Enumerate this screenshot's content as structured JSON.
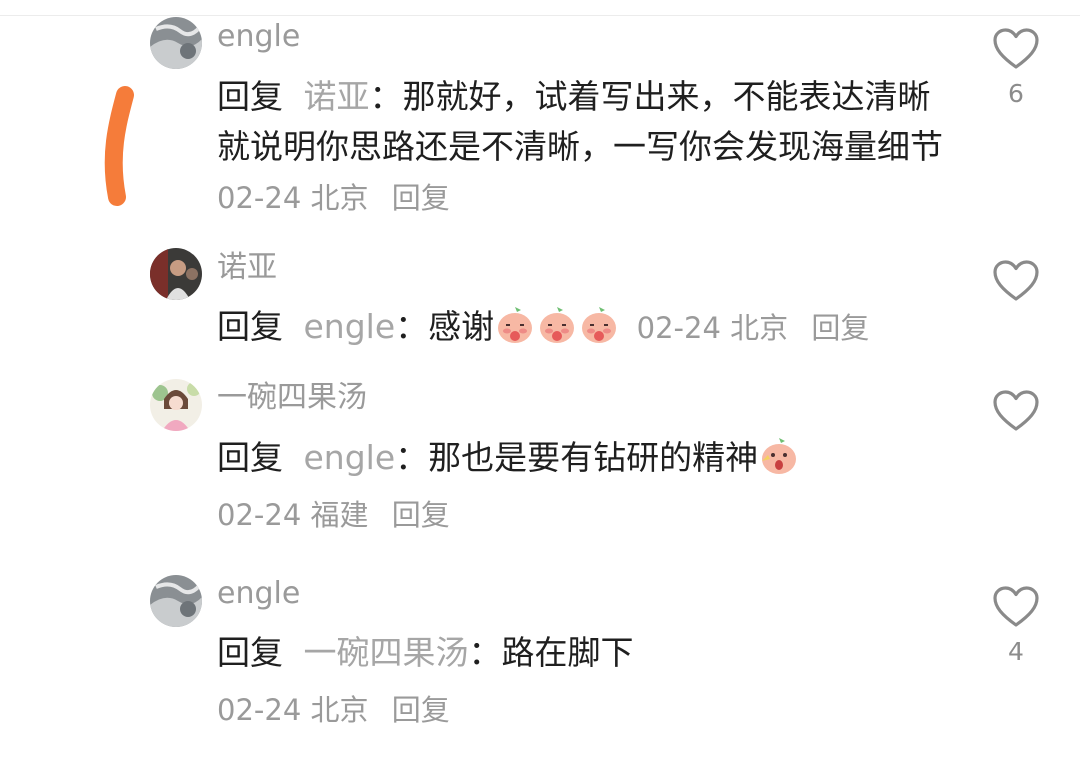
{
  "comments": [
    {
      "username": "engle",
      "reply_word": "回复",
      "reply_target": "诺亚",
      "colon": "：",
      "text": "那就好，试着写出来，不能表达清晰就说明你思路还是不清晰，一写你会发现海量细节",
      "date": "02-24",
      "location": "北京",
      "reply_link": "回复",
      "like_count": "6"
    },
    {
      "username": "诺亚",
      "reply_word": "回复",
      "reply_target": "engle",
      "colon": "：",
      "text": "感谢",
      "emojis": [
        "blush-emoji",
        "blush-emoji",
        "blush-emoji"
      ],
      "date": "02-24",
      "location": "北京",
      "reply_link": "回复",
      "like_count": ""
    },
    {
      "username": "一碗四果汤",
      "reply_word": "回复",
      "reply_target": "engle",
      "colon": "：",
      "text": "那也是要有钻研的精神",
      "emojis": [
        "wow-emoji"
      ],
      "date": "02-24",
      "location": "福建",
      "reply_link": "回复",
      "like_count": ""
    },
    {
      "username": "engle",
      "reply_word": "回复",
      "reply_target": "一碗四果汤",
      "colon": "：",
      "text": "路在脚下",
      "date": "02-24",
      "location": "北京",
      "reply_link": "回复",
      "like_count": "4"
    }
  ],
  "icons": {
    "like": "heart-outline-icon"
  },
  "colors": {
    "annotation_stroke": "#f57c3a",
    "secondary_text": "#9a9a9a",
    "primary_text": "#1f1f1f"
  }
}
